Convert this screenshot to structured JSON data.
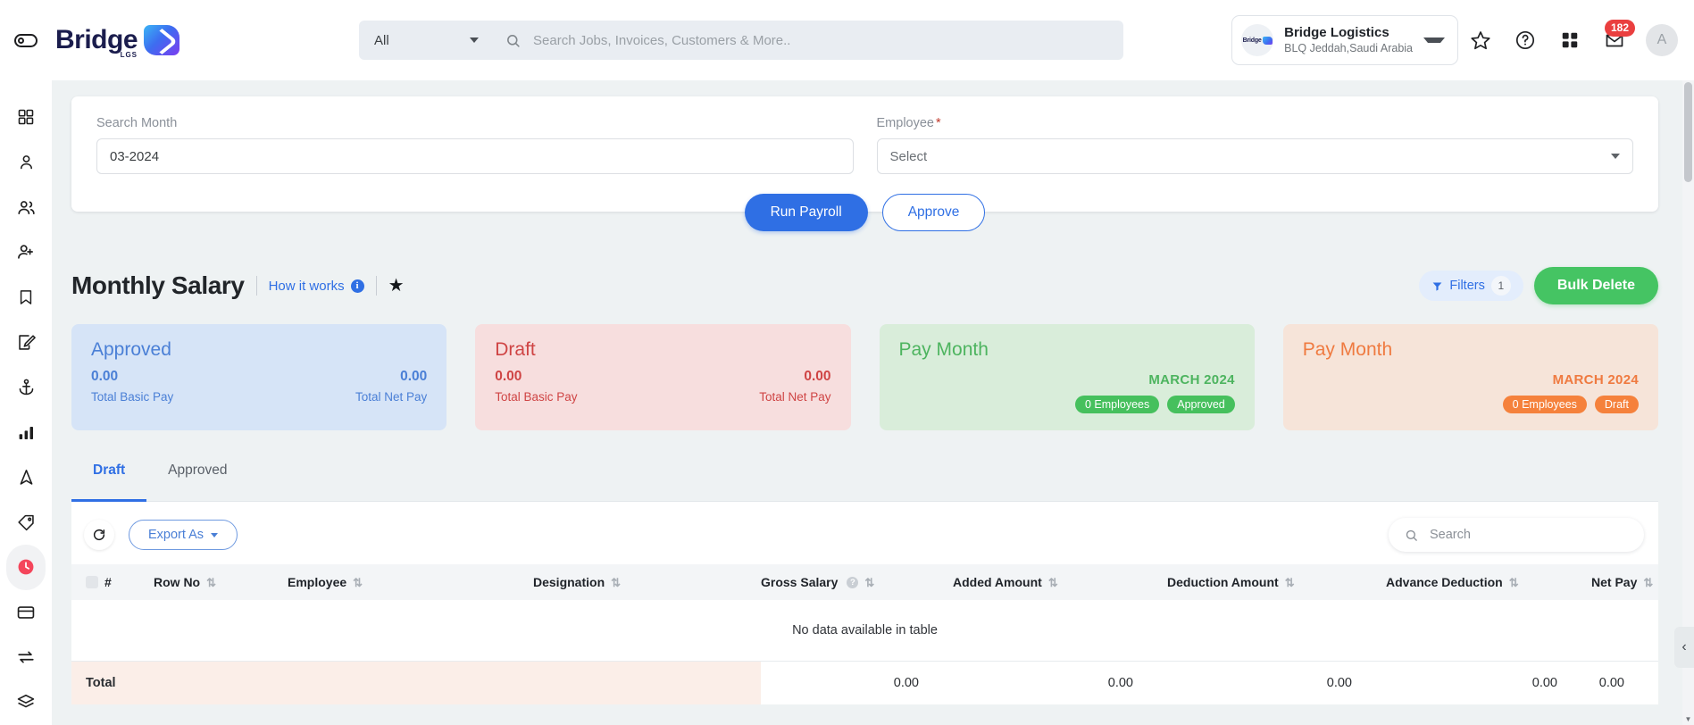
{
  "header": {
    "brand_name": "Bridge",
    "brand_sub": "LGS",
    "category_label": "All",
    "search_placeholder": "Search Jobs, Invoices, Customers & More..",
    "search_value": "",
    "org_name": "Bridge Logistics",
    "org_location": "BLQ Jeddah,Saudi Arabia",
    "org_avatar_text": "Bridge",
    "notification_count": "182",
    "user_initial": "A",
    "icons": {
      "menu_toggle": "sidebar-toggle-icon",
      "search": "search-icon",
      "favorite": "star-icon",
      "help": "question-circle-icon",
      "apps": "grid-apps-icon",
      "inbox": "inbox-icon",
      "avatar": "user-avatar"
    }
  },
  "sidebar": {
    "items": [
      {
        "name": "dashboard",
        "icon": "grid-dashboard-icon",
        "active": false
      },
      {
        "name": "profile",
        "icon": "user-icon",
        "active": false
      },
      {
        "name": "customers",
        "icon": "users-icon",
        "active": false
      },
      {
        "name": "add-user",
        "icon": "user-plus-icon",
        "active": false
      },
      {
        "name": "bookmarks",
        "icon": "bookmark-icon",
        "active": false
      },
      {
        "name": "edit",
        "icon": "edit-square-icon",
        "active": false
      },
      {
        "name": "shipping",
        "icon": "anchor-icon",
        "active": false
      },
      {
        "name": "reports",
        "icon": "bar-chart-icon",
        "active": false
      },
      {
        "name": "navigation",
        "icon": "navigation-arrow-icon",
        "active": false
      },
      {
        "name": "tags",
        "icon": "tag-icon",
        "active": false
      },
      {
        "name": "payroll",
        "icon": "clock-icon",
        "active": true
      },
      {
        "name": "payments",
        "icon": "credit-card-icon",
        "active": false
      },
      {
        "name": "transfers",
        "icon": "exchange-arrows-icon",
        "active": false
      },
      {
        "name": "layers",
        "icon": "layers-icon",
        "active": false
      }
    ]
  },
  "filter_panel": {
    "month_label": "Search Month",
    "month_value": "03-2024",
    "employee_label": "Employee",
    "employee_required": "*",
    "employee_value": "Select",
    "run_payroll_label": "Run Payroll",
    "approve_label": "Approve"
  },
  "page": {
    "title": "Monthly Salary",
    "how_it_works": "How it works",
    "filters_label": "Filters",
    "filters_count": "1",
    "bulk_delete_label": "Bulk Delete"
  },
  "cards": [
    {
      "title": "Approved",
      "style": "approved",
      "left_value": "0.00",
      "right_value": "0.00",
      "left_label": "Total Basic Pay",
      "right_label": "Total Net Pay"
    },
    {
      "title": "Draft",
      "style": "draft",
      "left_value": "0.00",
      "right_value": "0.00",
      "left_label": "Total Basic Pay",
      "right_label": "Total Net Pay"
    },
    {
      "title": "Pay Month",
      "style": "paygreen",
      "month": "MARCH 2024",
      "pill1": "0 Employees",
      "pill2": "Approved"
    },
    {
      "title": "Pay Month",
      "style": "payorange",
      "month": "MARCH 2024",
      "pill1": "0 Employees",
      "pill2": "Draft"
    }
  ],
  "tabs": [
    {
      "label": "Draft",
      "active": true
    },
    {
      "label": "Approved",
      "active": false
    }
  ],
  "table_toolbar": {
    "refresh_icon": "refresh-icon",
    "export_label": "Export As",
    "search_placeholder": "Search",
    "search_value": ""
  },
  "table": {
    "columns": [
      {
        "label": "#",
        "sortable": false,
        "align": "left"
      },
      {
        "label": "Row No",
        "sortable": true,
        "align": "left"
      },
      {
        "label": "Employee",
        "sortable": true,
        "align": "left"
      },
      {
        "label": "Designation",
        "sortable": true,
        "align": "left"
      },
      {
        "label": "Gross Salary",
        "sortable": true,
        "align": "left",
        "help": true
      },
      {
        "label": "Added Amount",
        "sortable": true,
        "align": "left"
      },
      {
        "label": "Deduction Amount",
        "sortable": true,
        "align": "left"
      },
      {
        "label": "Advance Deduction",
        "sortable": true,
        "align": "left"
      },
      {
        "label": "Net Pay",
        "sortable": true,
        "align": "left"
      }
    ],
    "empty_message": "No data available in table",
    "total_label": "Total",
    "totals": [
      "0.00",
      "0.00",
      "0.00",
      "0.00",
      "0.00"
    ]
  },
  "colors": {
    "accent_blue": "#2f6fe4",
    "green": "#45c463",
    "orange": "#f5813c",
    "red_badge": "#ea3f3f",
    "page_bg": "#eef2f3"
  }
}
